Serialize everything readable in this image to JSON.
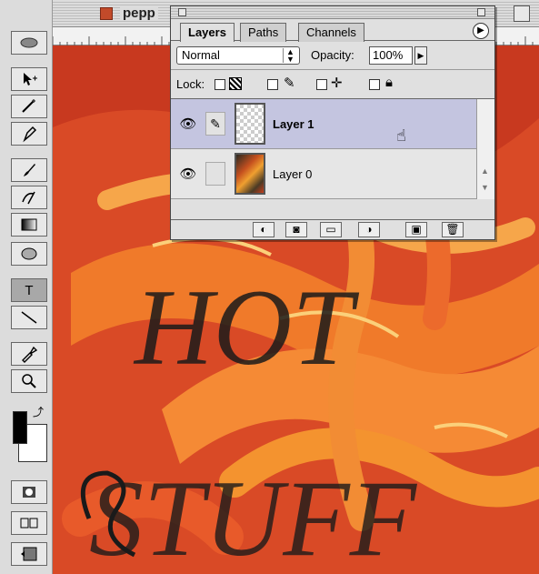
{
  "document": {
    "title": "pepp"
  },
  "toolbox": {
    "tools": [
      "feather-eye",
      "move",
      "magic-wand",
      "eyedropper-pen",
      "brush",
      "history-brush",
      "gradient",
      "blur",
      "type",
      "line",
      "eyedropper",
      "zoom"
    ],
    "type_tool_label": "T"
  },
  "layers_palette": {
    "tabs": [
      {
        "label": "Layers",
        "active": true
      },
      {
        "label": "Paths",
        "active": false
      },
      {
        "label": "Channels",
        "active": false
      }
    ],
    "blend_mode": "Normal",
    "opacity_label": "Opacity:",
    "opacity_value": "100%",
    "lock_label": "Lock:",
    "layers": [
      {
        "name": "Layer 1",
        "selected": true,
        "visible": true,
        "thumbnail": "transparent"
      },
      {
        "name": "Layer 0",
        "selected": false,
        "visible": true,
        "thumbnail": "image"
      }
    ],
    "bottom_buttons": [
      "layer-style",
      "add-mask",
      "new-set",
      "adjustment-layer",
      "new-layer",
      "trash"
    ]
  },
  "canvas": {
    "artwork_text": [
      "HOT",
      "STUFF"
    ],
    "colors": {
      "red": "#d94a26",
      "orange": "#f07a2a",
      "dark": "#1a1a1a"
    }
  }
}
